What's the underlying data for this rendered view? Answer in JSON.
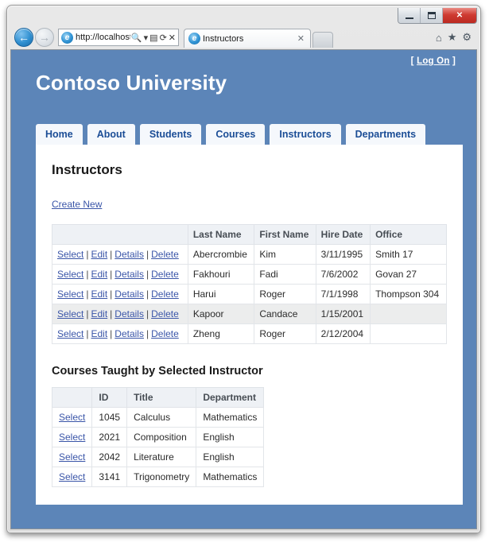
{
  "browser": {
    "window_controls": {
      "minimize": "–",
      "maximize": "□",
      "close": "✕"
    },
    "back_icon": "←",
    "forward_icon": "→",
    "address_value": "http://localhost:",
    "address_icons": {
      "search": "🔍",
      "caret": "▾",
      "compat": "▤",
      "refresh": "⟳",
      "stop": "✕"
    },
    "tab_title": "Instructors",
    "tab_close": "✕",
    "tools": {
      "home": "⌂",
      "favorites": "★",
      "settings": "⚙"
    }
  },
  "site": {
    "login_prefix": "[",
    "login_label": "Log On",
    "login_suffix": "]",
    "title": "Contoso University"
  },
  "menu": {
    "items": [
      {
        "label": "Home"
      },
      {
        "label": "About"
      },
      {
        "label": "Students"
      },
      {
        "label": "Courses"
      },
      {
        "label": "Instructors"
      },
      {
        "label": "Departments"
      }
    ]
  },
  "page": {
    "title": "Instructors",
    "create_new_label": "Create New"
  },
  "instructors_table": {
    "action_labels": {
      "select": "Select",
      "edit": "Edit",
      "details": "Details",
      "delete": "Delete"
    },
    "separator": "|",
    "columns": [
      "",
      "Last Name",
      "First Name",
      "Hire Date",
      "Office"
    ],
    "rows": [
      {
        "last_name": "Abercrombie",
        "first_name": "Kim",
        "hire_date": "3/11/1995",
        "office": "Smith 17",
        "selected": false
      },
      {
        "last_name": "Fakhouri",
        "first_name": "Fadi",
        "hire_date": "7/6/2002",
        "office": "Govan 27",
        "selected": false
      },
      {
        "last_name": "Harui",
        "first_name": "Roger",
        "hire_date": "7/1/1998",
        "office": "Thompson 304",
        "selected": false
      },
      {
        "last_name": "Kapoor",
        "first_name": "Candace",
        "hire_date": "1/15/2001",
        "office": "",
        "selected": true
      },
      {
        "last_name": "Zheng",
        "first_name": "Roger",
        "hire_date": "2/12/2004",
        "office": "",
        "selected": false
      }
    ]
  },
  "courses_section": {
    "heading": "Courses Taught by Selected Instructor",
    "select_label": "Select",
    "columns": [
      "",
      "ID",
      "Title",
      "Department"
    ],
    "rows": [
      {
        "id": "1045",
        "title": "Calculus",
        "department": "Mathematics"
      },
      {
        "id": "2021",
        "title": "Composition",
        "department": "English"
      },
      {
        "id": "2042",
        "title": "Literature",
        "department": "English"
      },
      {
        "id": "3141",
        "title": "Trigonometry",
        "department": "Mathematics"
      }
    ]
  },
  "colors": {
    "page_background": "#5c85b8",
    "menu_text": "#1b4d96",
    "link": "#3a55a8",
    "selected_row": "#eceded",
    "table_header": "#eef1f5"
  }
}
